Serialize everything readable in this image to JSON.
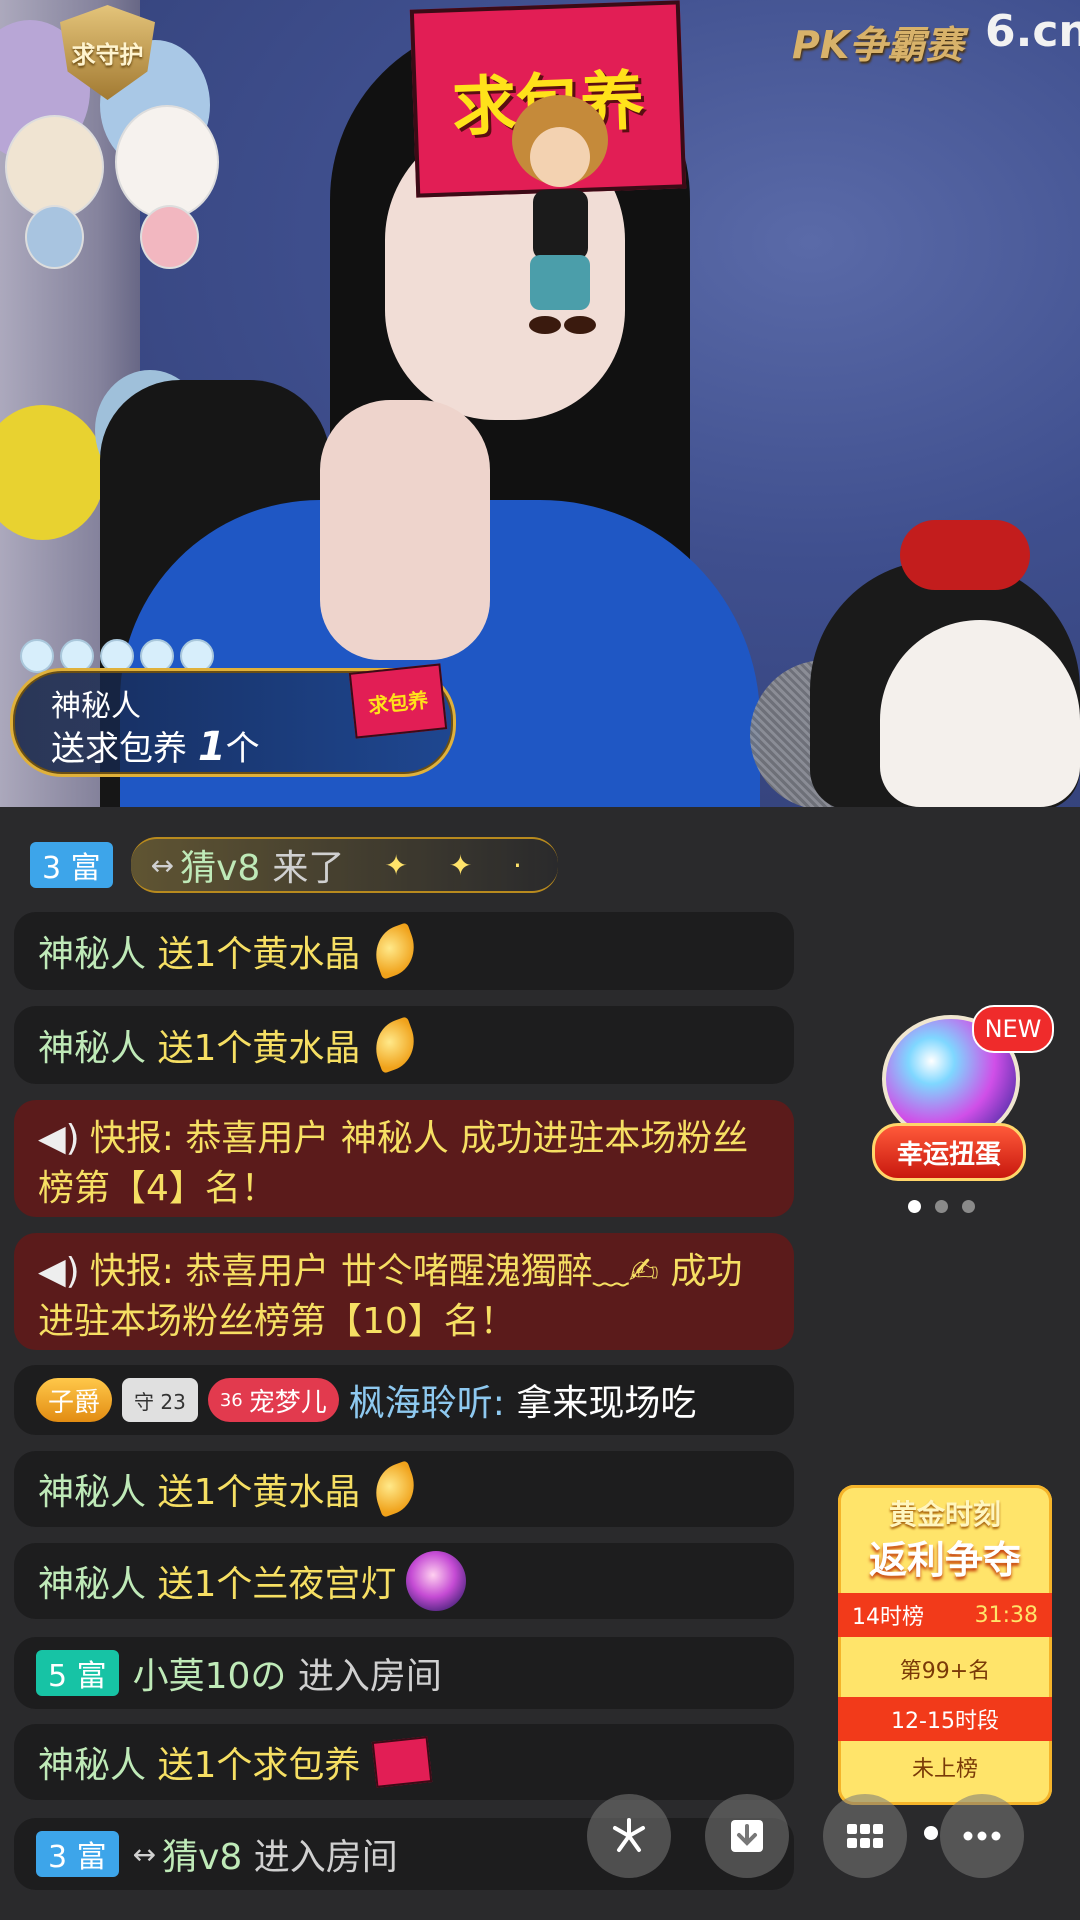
{
  "video": {
    "badge_text": "求守护",
    "envelope_text": "求包养",
    "brand_pk": "PK争霸赛",
    "brand_site": "6.cn"
  },
  "gift_popup": {
    "user": "神秘人",
    "send_prefix": "送求包养",
    "count": "1",
    "unit": "个",
    "icon_text": "求包养"
  },
  "chat": {
    "messages": [
      {
        "badge": "3 富",
        "arrow": "↔",
        "name": "猜v8",
        "text": "来了"
      },
      {
        "name": "神秘人",
        "text": "送1个黄水晶"
      },
      {
        "name": "神秘人",
        "text": "送1个黄水晶"
      },
      {
        "label": "快报:",
        "text": "恭喜用户 神秘人 成功进驻本场粉丝榜第【4】名！"
      },
      {
        "label": "快报:",
        "text": "恭喜用户 丗仒啫醒溾獨醉﹏✍ 成功进驻本场粉丝榜第【10】名！"
      },
      {
        "rank1": "子爵",
        "rank2": "守 23",
        "rank3_num": "36",
        "rank3_name": "宠梦儿",
        "name": "枫海聆听:",
        "text": "拿来现场吃"
      },
      {
        "name": "神秘人",
        "text": "送1个黄水晶"
      },
      {
        "name": "神秘人",
        "text": "送1个兰夜宫灯"
      },
      {
        "badge": "5 富",
        "name": "小莫10の",
        "text": "进入房间"
      },
      {
        "name": "神秘人",
        "text": "送1个求包养"
      },
      {
        "badge": "3 富",
        "arrow": "↔",
        "name": "猜v8",
        "text": "进入房间"
      }
    ]
  },
  "capsule": {
    "new_tag": "NEW",
    "button": "幸运扭蛋"
  },
  "gold_card": {
    "title1": "黄金时刻",
    "title2": "返利争夺",
    "row1_label": "14时榜",
    "row1_time": "31:38",
    "row2": "第99+名",
    "row3": "12-15时段",
    "row4": "未上榜"
  },
  "icons": {
    "share": "share-icon",
    "download": "download-icon",
    "grid": "grid-icon",
    "more": "more-icon"
  },
  "colors": {
    "chat_bg": "#1d1d1e",
    "alert_bg": "#5b1b1b",
    "name_green": "#bfeab8",
    "gold_text": "#f6df63"
  }
}
